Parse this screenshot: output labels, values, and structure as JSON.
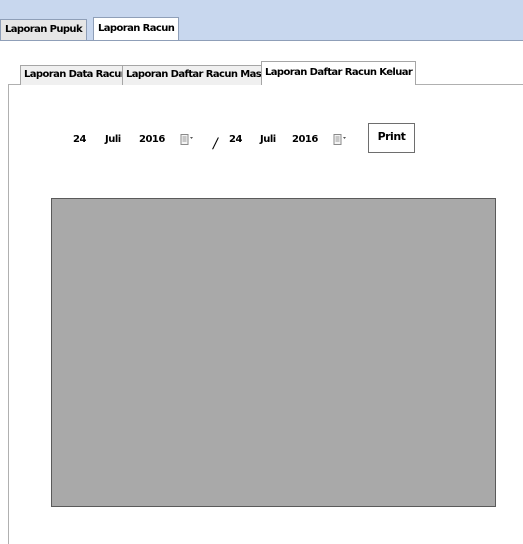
{
  "outer_tabs": [
    {
      "label": "Laporan Pupuk",
      "active": false
    },
    {
      "label": "Laporan Racun",
      "active": true
    }
  ],
  "inner_tabs": [
    {
      "label": "Laporan Data Racun",
      "active": false
    },
    {
      "label": "Laporan Daftar Racun Masuk",
      "active": false
    },
    {
      "label": "Laporan Daftar Racun Keluar",
      "active": true
    }
  ],
  "date_from": {
    "day": "24",
    "month": "Juli",
    "year": "2016",
    "icon": "calendar-icon"
  },
  "separator": "/",
  "date_to": {
    "day": "24",
    "month": "Juli",
    "year": "2016",
    "icon": "calendar-icon"
  },
  "print_label": "Print",
  "colors": {
    "header_bg": "#c8d7ee",
    "report_bg": "#a9a9a9"
  }
}
